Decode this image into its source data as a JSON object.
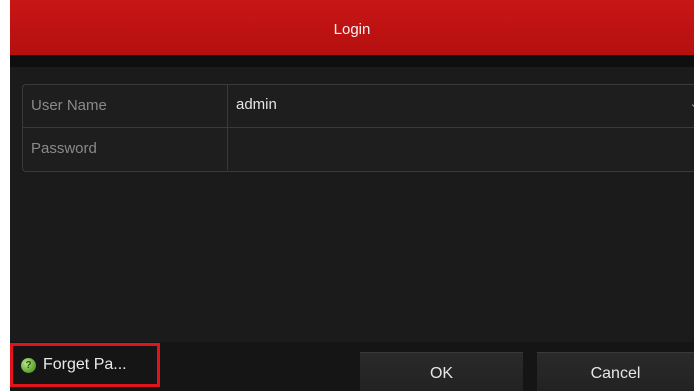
{
  "dialog": {
    "title": "Login"
  },
  "form": {
    "username_label": "User Name",
    "username_value": "admin",
    "password_label": "Password",
    "password_value": ""
  },
  "footer": {
    "forget_label": "Forget Pa...",
    "ok_label": "OK",
    "cancel_label": "Cancel"
  },
  "icons": {
    "help": "help-circle-icon",
    "dropdown": "chevron-down-icon"
  },
  "colors": {
    "titlebar": "#c81616",
    "highlight_border": "#e0141a",
    "dialog_background": "#1b1b1b",
    "help_icon": "#5aa02a"
  }
}
